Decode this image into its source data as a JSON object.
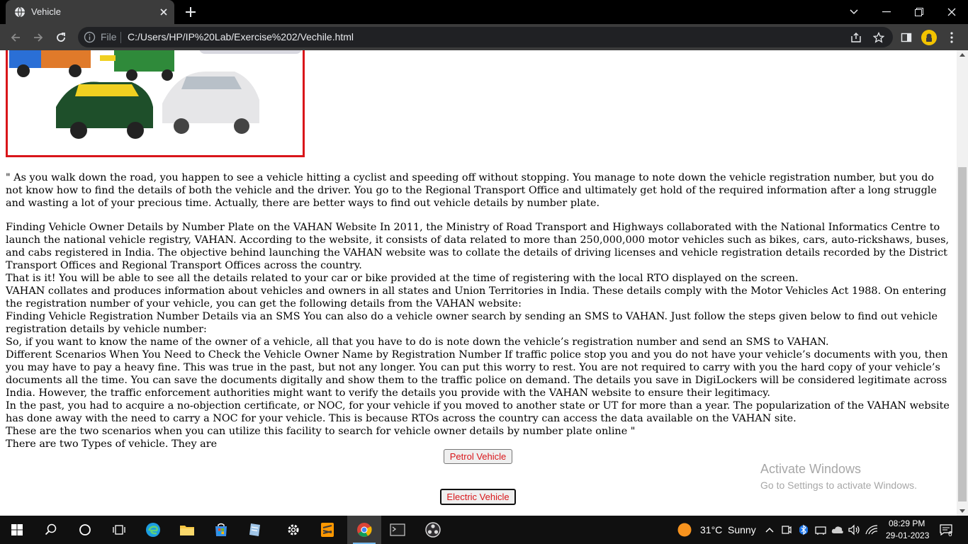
{
  "browser": {
    "tab_title": "Vehicle",
    "url_scheme_label": "File",
    "url": "C:/Users/HP/IP%20Lab/Exercise%202/Vechile.html"
  },
  "page": {
    "image_alt": "Vehicle images",
    "paragraph1": "\" As you walk down the road, you happen to see a vehicle hitting a cyclist and speeding off without stopping. You manage to note down the vehicle registration number, but you do not know how to find the details of both the vehicle and the driver. You go to the Regional Transport Office and ultimately get hold of the required information after a long struggle and wasting a lot of your precious time. Actually, there are better ways to find out vehicle details by number plate.",
    "lines": [
      "Finding Vehicle Owner Details by Number Plate on the VAHAN Website In 2011, the Ministry of Road Transport and Highways collaborated with the National Informatics Centre to launch the national vehicle registry, VAHAN. According to the website, it consists of data related to more than 250,000,000 motor vehicles such as bikes, cars, auto-rickshaws, buses, and cabs registered in India. The objective behind launching the VAHAN website was to collate the details of driving licenses and vehicle registration details recorded by the District Transport Offices and Regional Transport Offices across the country.",
      "That is it! You will be able to see all the details related to your car or bike provided at the time of registering with the local RTO displayed on the screen.",
      "VAHAN collates and produces information about vehicles and owners in all states and Union Territories in India. These details comply with the Motor Vehicles Act 1988. On entering the registration number of your vehicle, you can get the following details from the VAHAN website:",
      "Finding Vehicle Registration Number Details via an SMS You can also do a vehicle owner search by sending an SMS to VAHAN. Just follow the steps given below to find out vehicle registration details by vehicle number:",
      "So, if you want to know the name of the owner of a vehicle, all that you have to do is note down the vehicle’s registration number and send an SMS to VAHAN.",
      "Different Scenarios When You Need to Check the Vehicle Owner Name by Registration Number If traffic police stop you and you do not have your vehicle’s documents with you, then you may have to pay a heavy fine. This was true in the past, but not any longer. You can put this worry to rest. You are not required to carry with you the hard copy of your vehicle’s documents all the time. You can save the documents digitally and show them to the traffic police on demand. The details you save in DigiLockers will be considered legitimate across India. However, the traffic enforcement authorities might want to verify the details you provide with the VAHAN website to ensure their legitimacy.",
      "In the past, you had to acquire a no-objection certificate, or NOC, for your vehicle if you moved to another state or UT for more than a year. The popularization of the VAHAN website has done away with the need to carry a NOC for your vehicle. This is because RTOs across the country can access the data available on the VAHAN site.",
      "These are the two scenarios when you can utilize this facility to search for vehicle owner details by number plate online \"",
      "There are two Types of vehicle. They are"
    ],
    "petrol_button": "Petrol Vehicle",
    "electric_button": "Electric Vehicle"
  },
  "watermark": {
    "line1": "Activate Windows",
    "line2": "Go to Settings to activate Windows."
  },
  "taskbar": {
    "weather_temp": "31°C",
    "weather_desc": "Sunny",
    "time": "08:29 PM",
    "date": "29-01-2023",
    "notification_count": "6"
  },
  "colors": {
    "accent_red": "#d9161a",
    "chrome_dark": "#3c3c3c"
  }
}
